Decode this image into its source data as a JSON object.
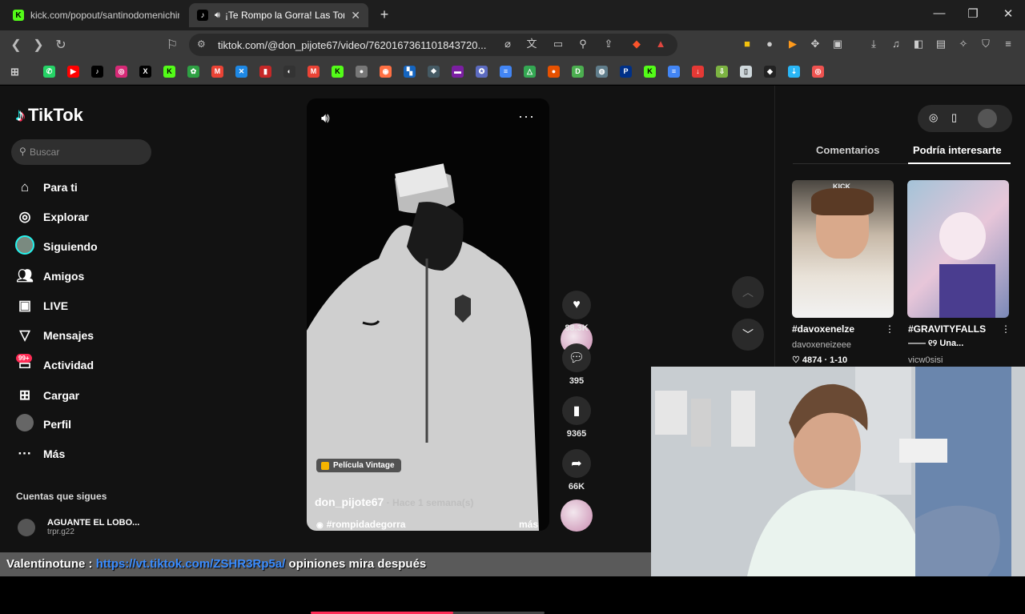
{
  "browser": {
    "tabs": [
      {
        "title": "kick.com/popout/santinodomenichin",
        "favicon": "K",
        "active": false
      },
      {
        "title": "¡Te Rompo la Gorra! Las Tortas",
        "favicon": "♪",
        "active": true
      }
    ],
    "new_tab": "+",
    "url": "tiktok.com/@don_pijote67/video/7620167361101843720...",
    "window_controls": {
      "minimize": "—",
      "maximize": "❐",
      "close": "✕"
    }
  },
  "tiktok": {
    "logo": "TikTok",
    "search_placeholder": "Buscar",
    "nav": [
      {
        "label": "Para ti",
        "icon": "home-icon"
      },
      {
        "label": "Explorar",
        "icon": "compass-icon"
      },
      {
        "label": "Siguiendo",
        "icon": "following-icon"
      },
      {
        "label": "Amigos",
        "icon": "friends-icon"
      },
      {
        "label": "LIVE",
        "icon": "live-icon"
      },
      {
        "label": "Mensajes",
        "icon": "messages-icon"
      },
      {
        "label": "Actividad",
        "icon": "activity-icon",
        "badge": "99+"
      },
      {
        "label": "Cargar",
        "icon": "upload-icon"
      },
      {
        "label": "Perfil",
        "icon": "profile-icon"
      },
      {
        "label": "Más",
        "icon": "more-icon"
      }
    ],
    "following_title": "Cuentas que sigues",
    "following": [
      {
        "name": "AGUANTE EL LOBO...",
        "handle": "trpr.g22"
      }
    ],
    "video": {
      "filter": "Película Vintage",
      "author": "don_pijote67",
      "time": " · Hace 1 semana(s)",
      "hashtag": "#rompidadegorra",
      "more": "más",
      "progress": 0.61,
      "likes": "88.3K",
      "comments": "395",
      "saves": "9365",
      "shares": "66K"
    },
    "right_panel": {
      "tabs": [
        "Comentarios",
        "Podría interesarte"
      ],
      "cards": [
        {
          "title": "#davoxenelze",
          "author": "davoxeneizeee",
          "stats": "♡ 4874 · 1-10",
          "thumb_text": "KICK"
        },
        {
          "title": "#GRAVITYFALLS",
          "author": "vicw0sisi",
          "stats": "—— ୧୨ Una...",
          "thumb_text": ""
        }
      ]
    }
  },
  "chat": {
    "user": "Valentinotune",
    "separator": " : ",
    "link": "https://vt.tiktok.com/ZSHR3Rp5a/",
    "message": " opiniones mira después"
  },
  "colors": {
    "accent": "#fe2c55",
    "cyan": "#25f4ee",
    "link": "#3a8cff"
  }
}
